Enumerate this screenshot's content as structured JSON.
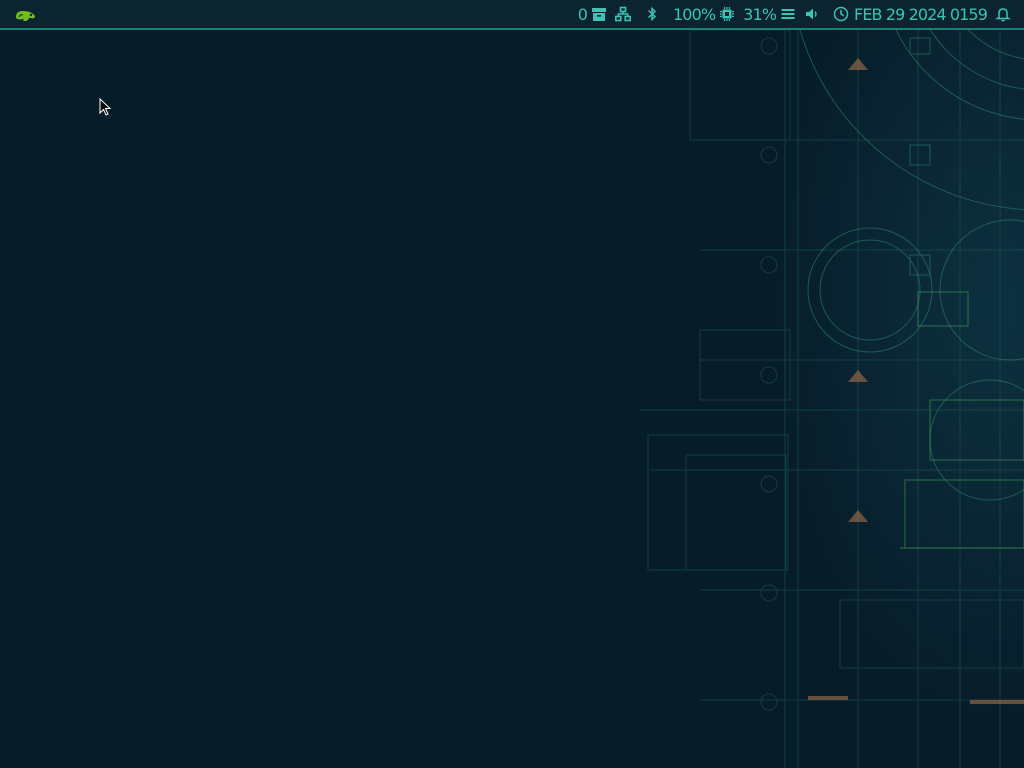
{
  "desktop": {
    "background_color": "#071c29",
    "wallpaper": "blueprint-architectural-drawing"
  },
  "topbar": {
    "accent_color": "#1f7d78",
    "text_color": "#3cc3b4",
    "logo": {
      "icon": "opensuse-chameleon-icon",
      "color": "#73ba25"
    },
    "tray": {
      "archive": {
        "count": "0",
        "icon": "archive-box-icon"
      },
      "network": {
        "icon": "wired-network-icon"
      },
      "bluetooth": {
        "icon": "bluetooth-icon"
      },
      "cpu": {
        "value": "100%",
        "icon": "cpu-chip-icon"
      },
      "memory": {
        "value": "31%",
        "icon": "memory-menu-icon"
      },
      "volume": {
        "icon": "speaker-icon"
      },
      "clock": {
        "value": "FEB 29 2024 0159",
        "icon": "clock-icon"
      },
      "notifications": {
        "icon": "bell-icon"
      }
    }
  }
}
